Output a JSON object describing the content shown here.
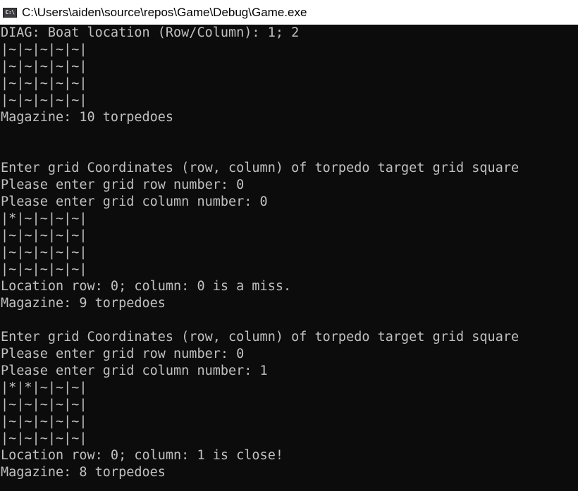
{
  "window": {
    "title": "C:\\Users\\aiden\\source\\repos\\Game\\Debug\\Game.exe",
    "icon": "console-app-icon",
    "icon_glyph": "C:\\"
  },
  "console": {
    "lines": [
      "DIAG: Boat location (Row/Column): 1; 2",
      "|~|~|~|~|~|",
      "|~|~|~|~|~|",
      "|~|~|~|~|~|",
      "|~|~|~|~|~|",
      "Magazine: 10 torpedoes",
      "",
      "",
      "Enter grid Coordinates (row, column) of torpedo target grid square",
      "Please enter grid row number: 0",
      "Please enter grid column number: 0",
      "|*|~|~|~|~|",
      "|~|~|~|~|~|",
      "|~|~|~|~|~|",
      "|~|~|~|~|~|",
      "Location row: 0; column: 0 is a miss.",
      "Magazine: 9 torpedoes",
      "",
      "Enter grid Coordinates (row, column) of torpedo target grid square",
      "Please enter grid row number: 0",
      "Please enter grid column number: 1",
      "|*|*|~|~|~|",
      "|~|~|~|~|~|",
      "|~|~|~|~|~|",
      "|~|~|~|~|~|",
      "Location row: 0; column: 1 is close!",
      "Magazine: 8 torpedoes"
    ]
  },
  "colors": {
    "console_background": "#0c0c0c",
    "console_text": "#c0c0c0",
    "titlebar_background": "#ffffff"
  }
}
